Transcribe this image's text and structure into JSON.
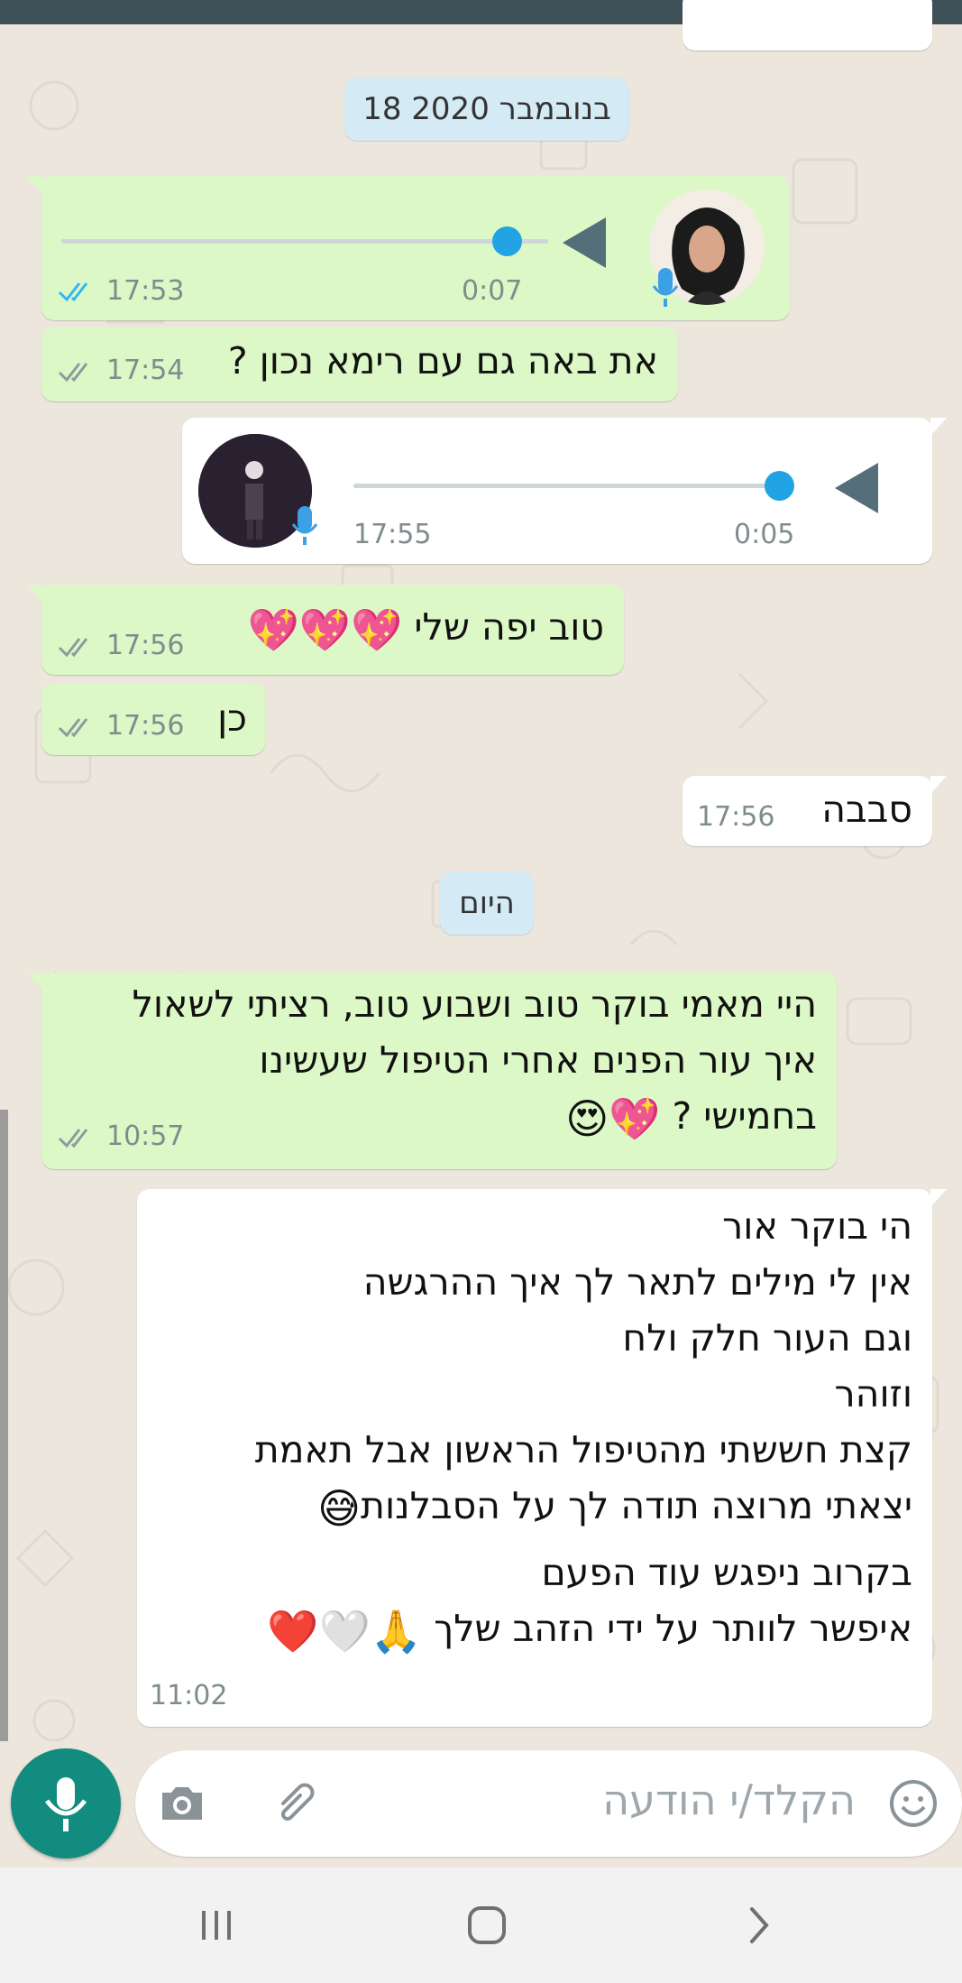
{
  "date_separators": {
    "nov18": "18 בנובמבר 2020",
    "today": "היום"
  },
  "messages": {
    "m1_voice": {
      "direction": "outgoing",
      "duration": "0:07",
      "time": "17:53",
      "status": "read",
      "tick_color": "#34b7f1"
    },
    "m2": {
      "direction": "outgoing",
      "text": "את באה גם עם רימא נכון ?",
      "time": "17:54",
      "status": "delivered"
    },
    "m3_voice": {
      "direction": "incoming",
      "duration": "0:05",
      "time": "17:55"
    },
    "m4": {
      "direction": "outgoing",
      "text": "טוב יפה שלי",
      "emoji": "💖💖💖",
      "time": "17:56",
      "status": "delivered"
    },
    "m5": {
      "direction": "outgoing",
      "text": "כן",
      "time": "17:56",
      "status": "delivered"
    },
    "m6": {
      "direction": "incoming",
      "text": "סבבה",
      "time": "17:56"
    },
    "m7": {
      "direction": "outgoing",
      "lines": [
        "היי מאמי בוקר טוב ושבוע טוב, רציתי לשאול",
        "איך עור הפנים אחרי הטיפול שעשינו",
        "בחמישי ?"
      ],
      "emoji": "💖😍",
      "time": "10:57",
      "status": "delivered"
    },
    "m8": {
      "direction": "incoming",
      "lines": [
        "הי בוקר אור",
        "אין לי מילים לתאר לך איך ההרגשה",
        "וגם העור חלק ולח",
        "וזוהר",
        "קצת חששתי מהטיפול הראשון אבל תאמת",
        "יצאתי מרוצה תודה לך על הסבלנות",
        "בקרוב ניפגש עוד הפעם",
        "איפשר לוותר על ידי הזהב שלך"
      ],
      "emoji_line6": "😅",
      "emoji_line8": "🙏🤍❤️",
      "time": "11:02"
    }
  },
  "composer": {
    "placeholder": "הקלד/י הודעה",
    "icons": [
      "emoji-icon",
      "attach-icon",
      "camera-icon",
      "mic-icon"
    ]
  },
  "navbar": {
    "icons": [
      "recent-apps-icon",
      "home-icon",
      "back-icon"
    ]
  },
  "colors": {
    "outgoing_bubble": "#dcf8c6",
    "incoming_bubble": "#ffffff",
    "accent": "#128c7e",
    "read_ticks": "#34b7f1",
    "delivered_ticks": "#8e9a9e"
  }
}
